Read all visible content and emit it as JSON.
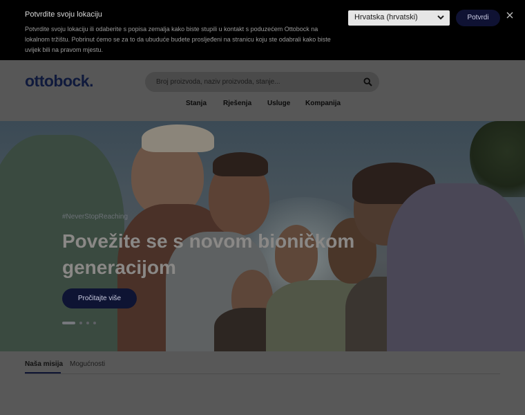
{
  "location_banner": {
    "title": "Potvrdite svoju lokaciju",
    "text": "Potvrdite svoju lokaciju ili odaberite s popisa zemalja kako biste stupili u kontakt s poduzećem Ottobock na lokalnom tržištu. Pobrinut ćemo se za to da ubuduće budete prosljeđeni na stranicu koju ste odabrali kako biste uvijek bili na pravom mjestu.",
    "selected_country": "Hrvatska (hrvatski)",
    "confirm_label": "Potvrdi",
    "select_icon": "chevron-down-icon",
    "close_icon": "close-icon"
  },
  "header": {
    "logo": "ottobock.",
    "search_placeholder": "Broj proizvoda, naziv proizvoda, stanje...",
    "search_icon": "search-icon",
    "nav": [
      "Stanja",
      "Rješenja",
      "Usluge",
      "Kompanija"
    ]
  },
  "hero": {
    "tag": "#NeverStopReaching",
    "title": "Povežite se s novom bioničkom generacijom",
    "button_label": "Pročitajte više",
    "slide_count": 4,
    "active_slide": 1
  },
  "tabs": {
    "items": [
      "Naša misija",
      "Mogućnosti"
    ],
    "active": 0
  },
  "colors": {
    "banner_bg": "#000000",
    "brand_navy": "#0e1433",
    "overlay_page": "#575757"
  }
}
